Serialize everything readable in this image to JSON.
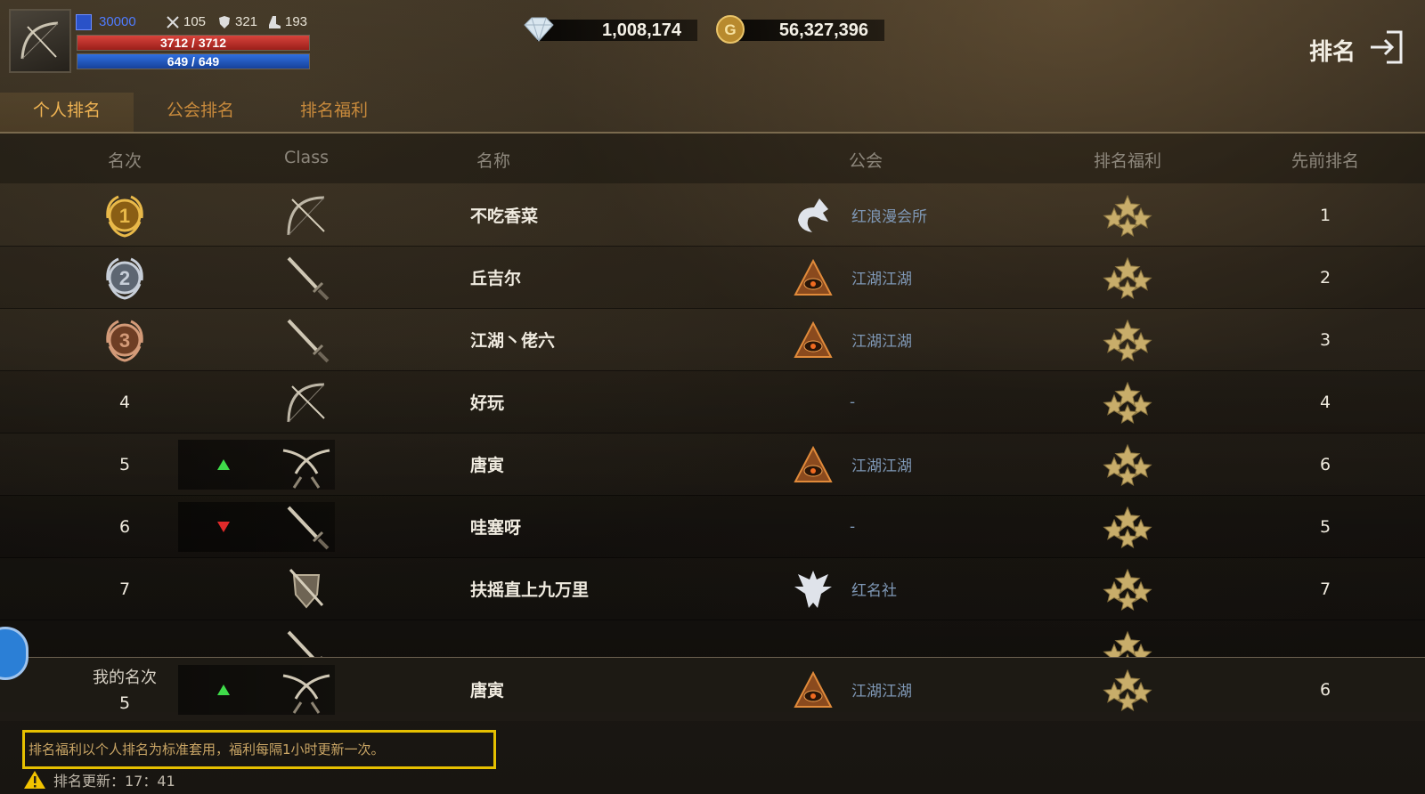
{
  "hud": {
    "level": "30000",
    "attack": "105",
    "defense": "321",
    "stat3": "193",
    "hp": "3712 / 3712",
    "mp": "649 / 649"
  },
  "currency": {
    "diamonds": "1,008,174",
    "gold": "56,327,396",
    "gold_glyph": "G"
  },
  "page_title": "排名",
  "tabs": [
    {
      "label": "个人排名",
      "active": true
    },
    {
      "label": "公会排名",
      "active": false
    },
    {
      "label": "排名福利",
      "active": false
    }
  ],
  "columns": {
    "rank": "名次",
    "class": "Class",
    "name": "名称",
    "guild": "公会",
    "reward": "排名福利",
    "prev": "先前排名"
  },
  "rows": [
    {
      "rank": "1",
      "medal": "gold",
      "class_icon": "bow-icon",
      "trend": "none",
      "name": "不吃香菜",
      "guild_icon": "wolf-emblem-icon",
      "guild": "红浪漫会所",
      "prev": "1"
    },
    {
      "rank": "2",
      "medal": "silver",
      "class_icon": "dagger-icon",
      "trend": "none",
      "name": "丘吉尔",
      "guild_icon": "eye-pyramid-icon",
      "guild": "江湖江湖",
      "prev": "2"
    },
    {
      "rank": "3",
      "medal": "bronze",
      "class_icon": "dagger-icon",
      "trend": "none",
      "name": "江湖丶佬六",
      "guild_icon": "eye-pyramid-icon",
      "guild": "江湖江湖",
      "prev": "3"
    },
    {
      "rank": "4",
      "medal": "",
      "class_icon": "bow-icon",
      "trend": "none",
      "name": "好玩",
      "guild_icon": "",
      "guild": "-",
      "prev": "4"
    },
    {
      "rank": "5",
      "medal": "",
      "class_icon": "dual-blades-icon",
      "trend": "up",
      "name": "唐寅",
      "guild_icon": "eye-pyramid-icon",
      "guild": "江湖江湖",
      "prev": "6"
    },
    {
      "rank": "6",
      "medal": "",
      "class_icon": "dagger-icon",
      "trend": "down",
      "name": "哇塞呀",
      "guild_icon": "",
      "guild": "-",
      "prev": "5"
    },
    {
      "rank": "7",
      "medal": "",
      "class_icon": "shield-sword-icon",
      "trend": "none",
      "name": "扶摇直上九万里",
      "guild_icon": "eagle-emblem-icon",
      "guild": "红名社",
      "prev": "7"
    }
  ],
  "my_rank": {
    "label": "我的名次",
    "rank": "5",
    "trend": "up",
    "class_icon": "dual-blades-icon",
    "name": "唐寅",
    "guild_icon": "eye-pyramid-icon",
    "guild": "江湖江湖",
    "prev": "6"
  },
  "notice": "排名福利以个人排名为标准套用，福利每隔1小时更新一次。",
  "update_time": "排名更新：17：41",
  "colors": {
    "accent": "#f0b453",
    "tab_inactive": "#c88a3c",
    "guild_text": "#7f98b6",
    "up": "#3fdc4a",
    "down": "#e02a2a",
    "notice_border": "#e6c000"
  }
}
